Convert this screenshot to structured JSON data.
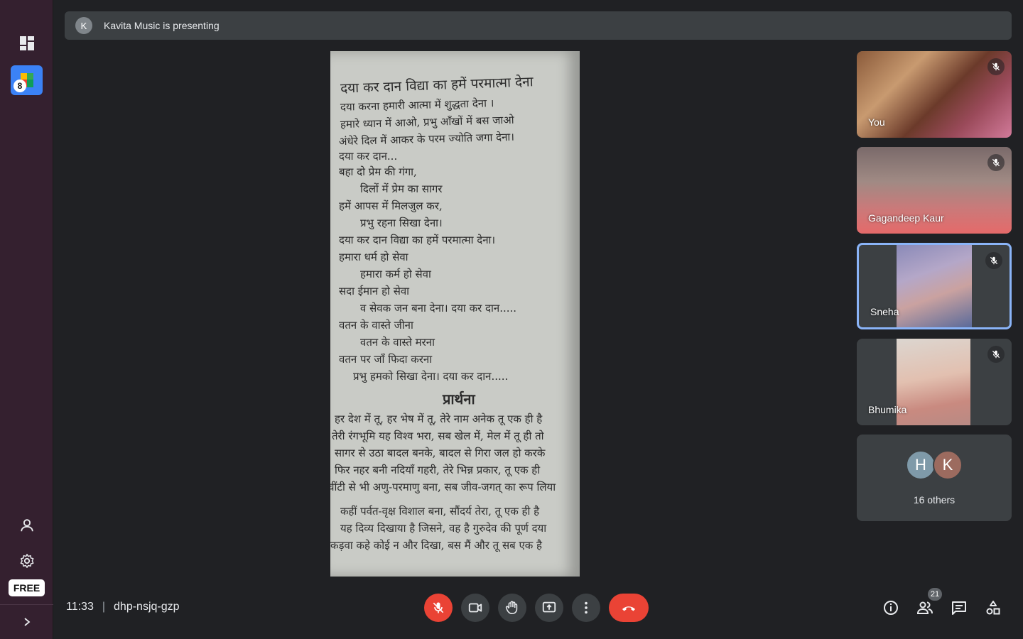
{
  "sidebar": {
    "icons": [
      "dashboard-icon",
      "user-icon",
      "gear-icon",
      "chevron-right-icon"
    ],
    "app_badge_count": "8",
    "plan_label": "FREE"
  },
  "banner": {
    "avatar_initial": "K",
    "text": "Kavita Music is presenting"
  },
  "document": {
    "title": "दया कर दान विद्या का हमें परमात्मा देना",
    "lines": [
      "दया करना हमारी आत्मा में शुद्धता देना ।",
      "हमारे ध्यान में आओ, प्रभु आँखों में बस जाओ",
      "अंधेरे दिल में आकर के परम ज्योति जगा देना।",
      "दया कर दान...",
      "बहा दो प्रेम की गंगा,",
      "दिलों में प्रेम का सागर",
      "हमें आपस में मिलजुल कर,",
      "प्रभु रहना सिखा देना।",
      "दया कर दान विद्या का हमें परमात्मा देना।",
      "हमारा धर्म हो सेवा",
      "हमारा कर्म हो सेवा",
      "सदा ईमान हो सेवा",
      "व सेवक जन बना देना। दया कर दान.....",
      "वतन के वास्ते जीना",
      "वतन के वास्ते मरना",
      "वतन पर जाँ फिदा करना",
      "प्रभु हमको सिखा देना। दया कर दान....."
    ],
    "heading": "प्रार्थना",
    "lines2": [
      "हर देश में तू, हर भेष में तू, तेरे नाम अनेक तू एक ही है",
      "तेरी रंगभूमि यह विश्व भरा, सब खेल में, मेल में तू ही तो",
      "सागर से उठा बादल बनके, बादल से गिरा जल हो करके",
      "फिर नहर बनी नदियाँ गहरी, तेरे भिन्न प्रकार, तू एक ही",
      "चींटी से भी अणु-परमाणु बना, सब जीव-जगत् का रूप लिया",
      "कहीं पर्वत-वृक्ष विशाल बना, सौंदर्य तेरा, तू एक ही है",
      "यह दिव्य दिखाया है जिसने, वह है गुरुदेव की पूर्ण दया",
      "कड़वा कहे कोई न और दिखा, बस मैं और तू सब एक है"
    ]
  },
  "participants": [
    {
      "name": "You",
      "muted": true
    },
    {
      "name": "Gagandeep Kaur",
      "muted": true
    },
    {
      "name": "Sneha",
      "muted": true
    },
    {
      "name": "Bhumika",
      "muted": true
    }
  ],
  "others": {
    "initials": [
      "H",
      "K"
    ],
    "colors": [
      "#7f9aa9",
      "#9c6b5f"
    ],
    "label": "16 others"
  },
  "meeting": {
    "time": "11:33",
    "separator": "|",
    "code": "dhp-nsjq-gzp"
  },
  "controls": {
    "participant_count": "21"
  },
  "colors": {
    "danger": "#ea4335",
    "active_border": "#8ab4f8",
    "surface": "#3c4043",
    "background": "#202124",
    "sidebar": "#34202f"
  }
}
